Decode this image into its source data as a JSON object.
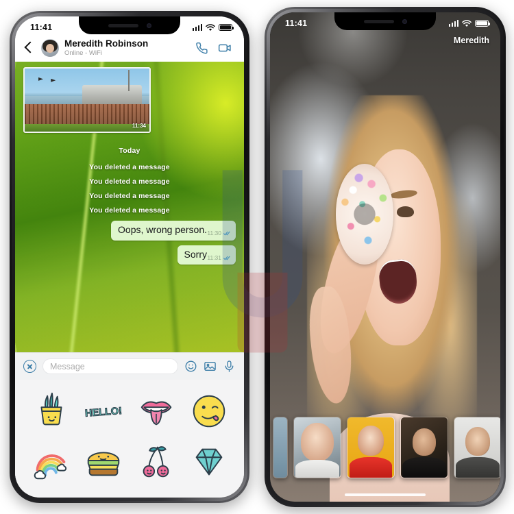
{
  "left_phone": {
    "status_bar": {
      "time": "11:41",
      "icons": [
        "signal-bars",
        "wifi",
        "battery"
      ]
    },
    "header": {
      "back_icon": "back-chevron-icon",
      "avatar": "contact-avatar",
      "contact_name": "Meredith Robinson",
      "status_text": "Online - WiFi",
      "call_icon": "phone-call-icon",
      "video_icon": "video-camera-icon"
    },
    "conversation": {
      "photo_message": {
        "caption": "seaside-pier-photo",
        "time": "11:34"
      },
      "day_divider": "Today",
      "deleted_messages": [
        "You deleted a message",
        "You deleted a message",
        "You deleted a message",
        "You deleted a message"
      ],
      "bubbles": [
        {
          "text": "Oops, wrong person.",
          "time": "11:30",
          "status": "read"
        },
        {
          "text": "Sorry",
          "time": "11:31",
          "status": "read"
        }
      ]
    },
    "input_bar": {
      "close_icon": "close-circle-icon",
      "placeholder": "Message",
      "value": "",
      "emoji_icon": "smiley-icon",
      "gallery_icon": "image-icon",
      "mic_icon": "microphone-icon"
    },
    "sticker_tray": {
      "stickers": [
        {
          "name": "cactus-plant-sticker",
          "label": "Cactus"
        },
        {
          "name": "hello-text-sticker",
          "label": "HELLO!"
        },
        {
          "name": "lips-tongue-sticker",
          "label": "Lips"
        },
        {
          "name": "winking-face-sticker",
          "label": "Winking face"
        },
        {
          "name": "rainbow-sticker",
          "label": "Rainbow"
        },
        {
          "name": "burger-sticker",
          "label": "Burger"
        },
        {
          "name": "cherries-sticker",
          "label": "Cherries"
        },
        {
          "name": "diamond-sticker",
          "label": "Diamond"
        }
      ]
    }
  },
  "right_phone": {
    "status_bar": {
      "time": "11:41",
      "icons": [
        "signal-bars",
        "wifi",
        "battery"
      ]
    },
    "story": {
      "author_name": "Meredith",
      "photo": "woman-holding-sprinkled-donut"
    },
    "thumbnail_strip": {
      "items": [
        {
          "name": "thumbnail-1",
          "label": "Blonde woman portrait"
        },
        {
          "name": "thumbnail-2",
          "label": "Red-haired woman on yellow"
        },
        {
          "name": "thumbnail-3",
          "label": "Man with glasses"
        },
        {
          "name": "thumbnail-4",
          "label": "Young man in hat"
        },
        {
          "name": "thumbnail-5",
          "label": "Partially visible portrait"
        }
      ]
    }
  },
  "colors": {
    "accent_blue": "#3d7ea8",
    "bubble_green": "#dff6cd",
    "tick_blue": "#4fa5c9",
    "wallpaper_green": "#74bf1c",
    "tray_bg": "#f4f4f5"
  }
}
